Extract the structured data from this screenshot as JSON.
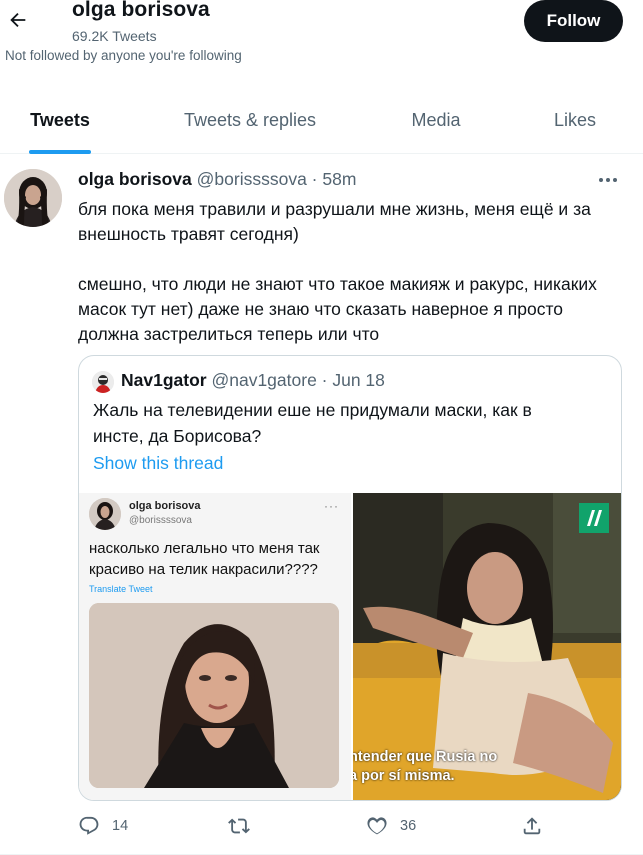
{
  "header": {
    "back_icon": "arrow-left-icon",
    "profile_name": "olga borisova",
    "tweet_count": "69.2K Tweets",
    "follow_status": "Not followed by anyone you're following",
    "follow_label": "Follow"
  },
  "tabs": [
    {
      "label": "Tweets",
      "active": true
    },
    {
      "label": "Tweets & replies",
      "active": false
    },
    {
      "label": "Media",
      "active": false
    },
    {
      "label": "Likes",
      "active": false
    }
  ],
  "tweet": {
    "author_name": "olga borisova",
    "author_meta": "@borissssova · 58m",
    "more_icon": "more-horizontal-icon",
    "paragraphs": [
      "бля пока меня травили и разрушали мне жизнь, меня ещё и за внешность травят сегодня)",
      "смешно, что люди не знают что такое макияж и ракурс, никаких масок тут нет) даже не знаю что сказать наверное я просто должна застрелиться теперь или что"
    ],
    "quote": {
      "author_name": "Nav1gator",
      "author_meta": "@nav1gatore · Jun 18",
      "text": "Жаль на телевидении еше не придумали маски, как в инсте, да Борисова?",
      "thread_link": "Show this thread",
      "media_left": {
        "name": "olga borisova",
        "handle": "@borissssova",
        "dots": "···",
        "text": "насколько легально что меня так красиво на телик накрасили????",
        "translate": "Translate Tweet"
      },
      "media_right": {
        "subtitle_line1": "ntender que Rusia no",
        "subtitle_line2": "a por sí misma."
      }
    },
    "actions": {
      "reply_count": "14",
      "retweet_count": "",
      "like_count": "36",
      "reply_icon": "reply-icon",
      "retweet_icon": "retweet-icon",
      "like_icon": "heart-icon",
      "share_icon": "share-icon"
    }
  },
  "colors": {
    "accent": "#1d9bf0",
    "text_primary": "#0f1419",
    "text_secondary": "#536471",
    "follow_bg": "#0f1419"
  }
}
